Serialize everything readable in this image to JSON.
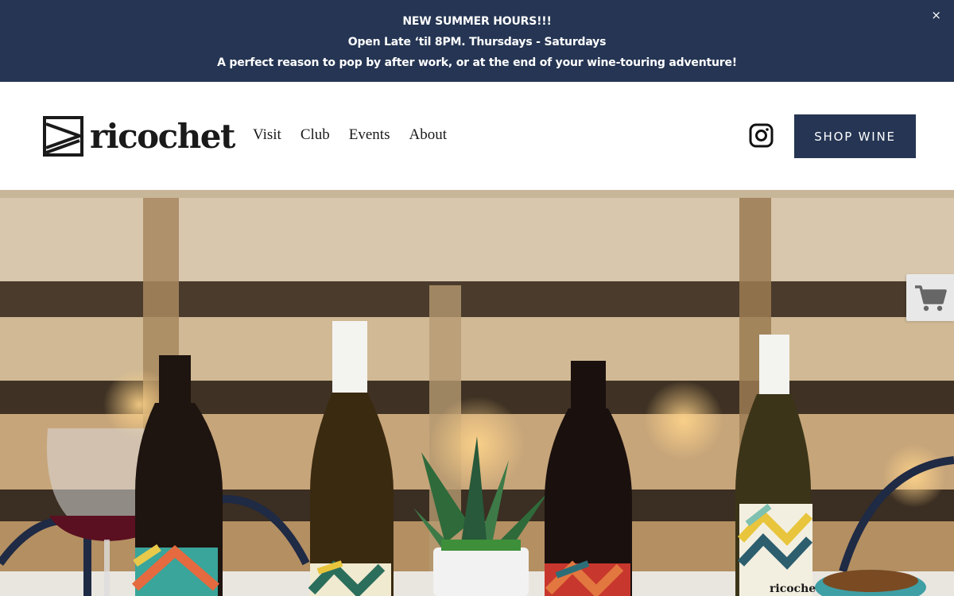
{
  "announcement": {
    "lines": [
      "NEW SUMMER HOURS!!!",
      "Open Late ‘til 8PM. Thursdays - Saturdays",
      "A perfect reason to pop by after work, or at the end of your wine-touring adventure!"
    ],
    "close_label": "×",
    "background": "#253553"
  },
  "header": {
    "logo_text": "ricochet",
    "nav": [
      "Visit",
      "Club",
      "Events",
      "About"
    ],
    "social_icon": "instagram-icon",
    "shop_button": "SHOP WINE",
    "accent": "#253553"
  },
  "hero": {
    "bottle_labels": [
      "ricochet"
    ]
  },
  "cart": {
    "icon": "shopping-cart-icon"
  }
}
